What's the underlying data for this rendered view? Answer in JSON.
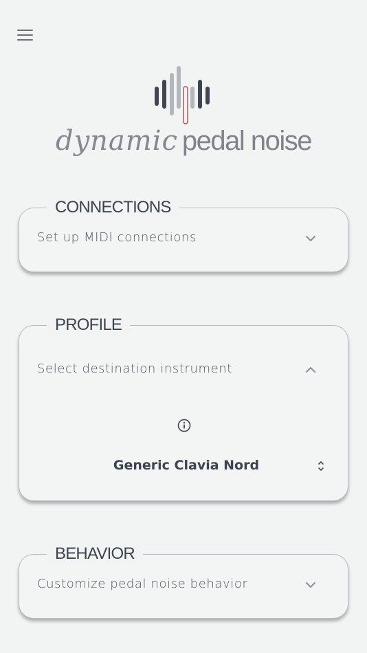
{
  "header": {
    "menu_icon": "hamburger-menu-icon"
  },
  "logo": {
    "mark_icon": "waveform-pedal-logo",
    "text_script": "dynamic",
    "text_plain": "pedal noise",
    "colors": {
      "bars_dark": "#3f4651",
      "bars_light": "#b2b7be",
      "accent": "#b5474f"
    }
  },
  "sections": {
    "connections": {
      "title": "CONNECTIONS",
      "summary": "Set up MIDI connections",
      "expanded": false,
      "chevron_icon": "chevron-down-icon"
    },
    "profile": {
      "title": "PROFILE",
      "summary": "Select destination instrument",
      "expanded": true,
      "chevron_icon": "chevron-up-icon",
      "info_icon": "info-circle-icon",
      "instrument": "Generic Clavia Nord",
      "select_icon": "unfold-more-icon"
    },
    "behavior": {
      "title": "BEHAVIOR",
      "summary": "Customize pedal noise behavior",
      "expanded": false,
      "chevron_icon": "chevron-down-icon"
    }
  },
  "colors": {
    "background": "#f2f3f3",
    "card_border": "#b9bcc1",
    "text": "#3f4651"
  }
}
